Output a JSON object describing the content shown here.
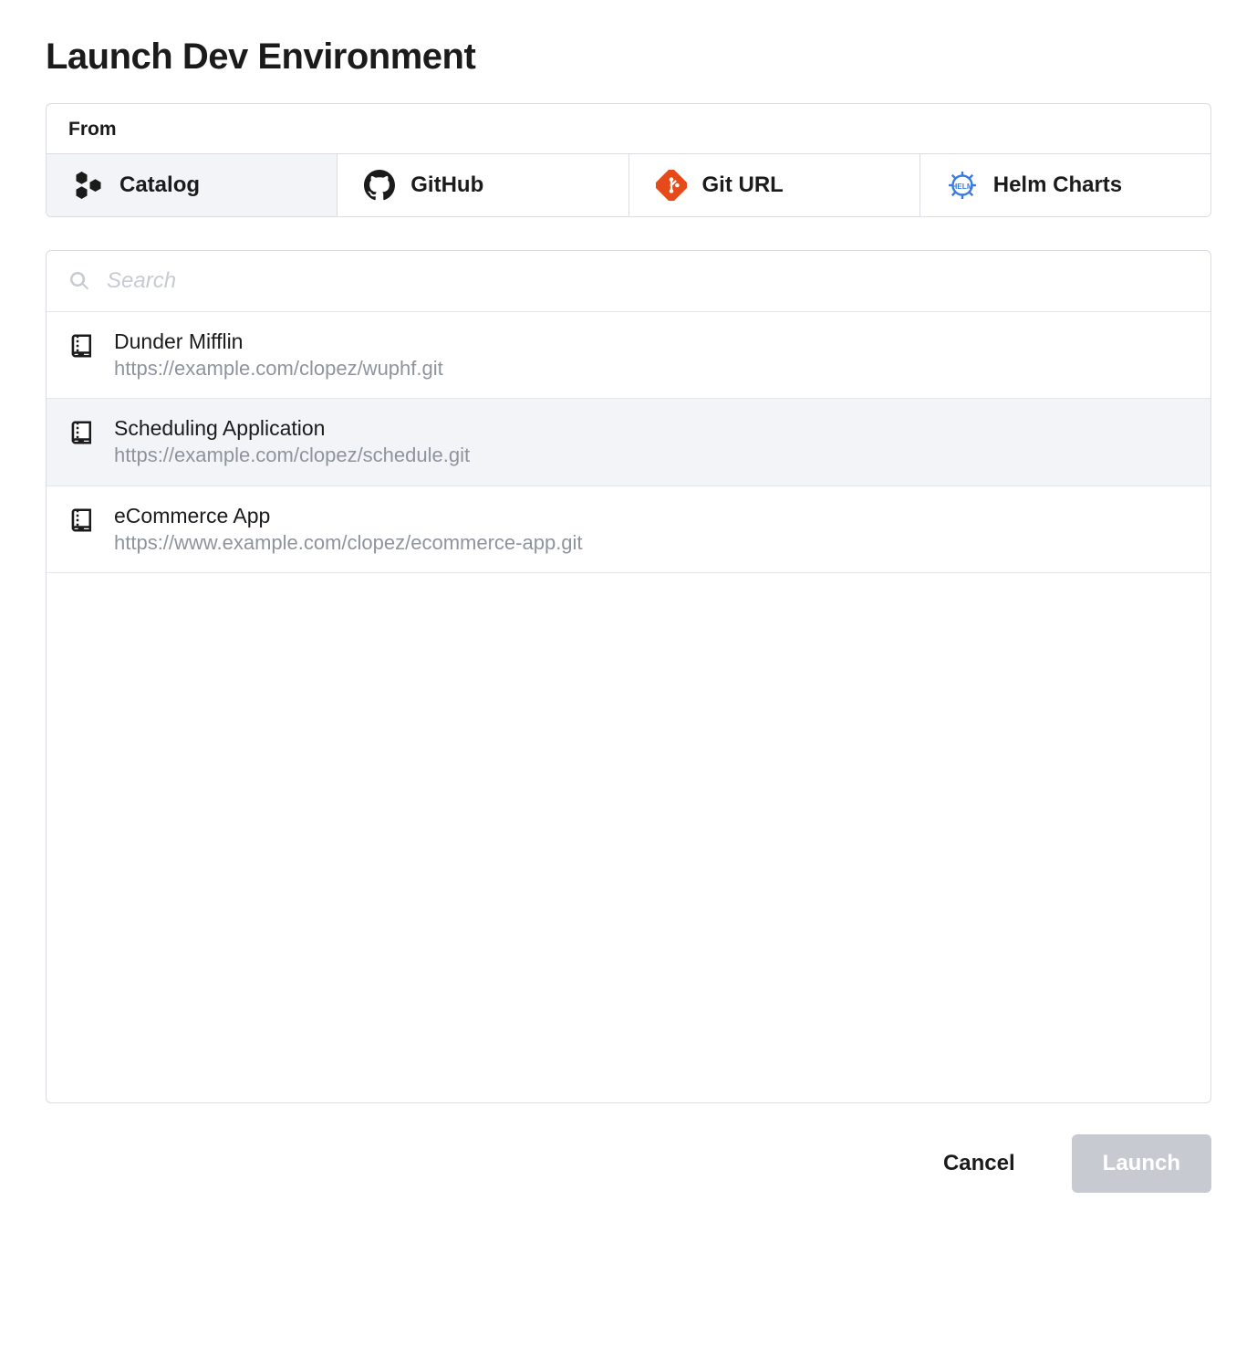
{
  "title": "Launch Dev Environment",
  "from": {
    "label": "From",
    "tabs": [
      {
        "id": "catalog",
        "label": "Catalog",
        "icon": "catalog-icon",
        "selected": true
      },
      {
        "id": "github",
        "label": "GitHub",
        "icon": "github-icon",
        "selected": false
      },
      {
        "id": "giturl",
        "label": "Git URL",
        "icon": "git-icon",
        "selected": false
      },
      {
        "id": "helm",
        "label": "Helm Charts",
        "icon": "helm-icon",
        "selected": false
      }
    ]
  },
  "search": {
    "placeholder": "Search",
    "value": ""
  },
  "items": [
    {
      "name": "Dunder Mifflin",
      "url": "https://example.com/clopez/wuphf.git",
      "selected": false
    },
    {
      "name": "Scheduling Application",
      "url": "https://example.com/clopez/schedule.git",
      "selected": true
    },
    {
      "name": "eCommerce App",
      "url": "https://www.example.com/clopez/ecommerce-app.git",
      "selected": false
    }
  ],
  "footer": {
    "cancel": "Cancel",
    "launch": "Launch"
  }
}
